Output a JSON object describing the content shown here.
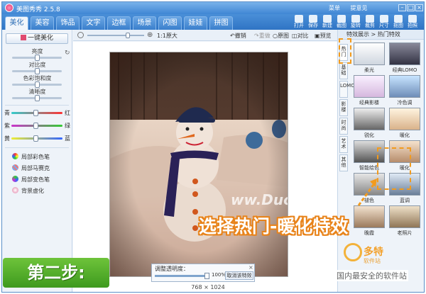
{
  "app": {
    "title": "美图秀秀 2.5.8"
  },
  "title_links": [
    "菜单",
    "提意见"
  ],
  "window_controls": [
    "minimize-icon",
    "maximize-icon",
    "close-icon"
  ],
  "tabs": [
    "美化",
    "美容",
    "饰品",
    "文字",
    "边框",
    "场景",
    "闪图",
    "娃娃",
    "拼图"
  ],
  "active_tab": "美化",
  "top_tools": [
    "打开",
    "保存",
    "新建",
    "截图",
    "旋转",
    "裁剪",
    "尺寸",
    "抠图",
    "拍照"
  ],
  "toolbar2": {
    "zoom_ratio": "1:1原大",
    "undo": "撤销",
    "redo": "重做",
    "original": "原图",
    "compare": "对比",
    "preview": "预览"
  },
  "left": {
    "one_key": "一键美化",
    "adjustments": [
      "亮度",
      "对比度",
      "色彩饱和度",
      "清晰度"
    ],
    "adjust_levels": [
      0.5,
      0.5,
      0.5,
      0.5
    ],
    "color_balance": [
      {
        "left": "青",
        "right": "红",
        "level": 0.47
      },
      {
        "left": "紫",
        "right": "绿",
        "level": 0.47
      },
      {
        "left": "黄",
        "right": "蓝",
        "level": 0.47
      }
    ],
    "tools": [
      "局部彩色笔",
      "局部马赛克",
      "局部变色笔",
      "背景虚化"
    ]
  },
  "canvas": {
    "watermark": "ww.Duote.com",
    "image_size": "768 × 1024"
  },
  "opacity_popup": {
    "title": "调整透明度：",
    "value": "100%",
    "level": 1.0,
    "cancel": "取消该特效"
  },
  "right": {
    "header": "特效展示 > 热门特效",
    "side_tabs": [
      "热门",
      "基础",
      "LOMO",
      "影楼",
      "时尚",
      "艺术",
      "其他"
    ],
    "effects": [
      "柔光",
      "经典LOMO",
      "经典影楼",
      "冷色调",
      "锐化",
      "暖化",
      "智能绘色",
      "暖化",
      "褪色",
      "蓝调",
      "晚霞",
      "老照片"
    ]
  },
  "overlay": {
    "callout": "选择热门-暖化特效",
    "step": "第二步:",
    "wm_name": "多特",
    "wm_sub": "软件站",
    "wm_slogan": "国内最安全的软件站"
  }
}
